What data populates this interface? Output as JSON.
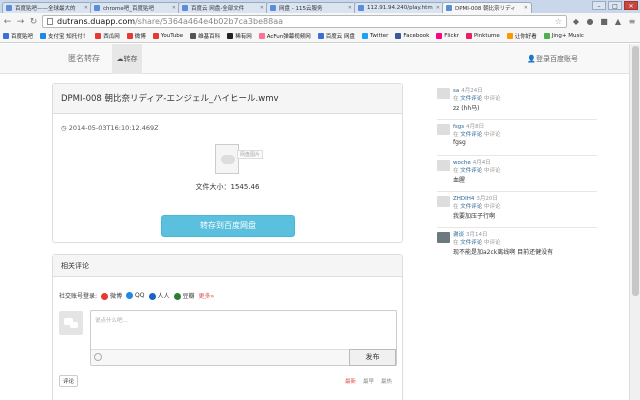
{
  "browser": {
    "tabs": [
      {
        "label": "百度贴吧——全球最大的"
      },
      {
        "label": "chrome吧_百度贴吧"
      },
      {
        "label": "百度云 网盘-全部文件"
      },
      {
        "label": "网盘 - 115云服务"
      },
      {
        "label": "112.91.94.240/play.htm"
      },
      {
        "label": "DPMI-008 朝比奈リディ",
        "active": true
      }
    ],
    "url_host": "dutrans.duapp.com",
    "url_path": "/share/5364a464e4b02b7ca3be88aa",
    "bookmarks": [
      {
        "label": "百度贴吧",
        "color": "#3a6fd8"
      },
      {
        "label": "支付宝 知托付！",
        "color": "#1e88e5"
      },
      {
        "label": "西瓜网",
        "color": "#e53935"
      },
      {
        "label": "微博",
        "color": "#e53935"
      },
      {
        "label": "YouTube",
        "color": "#e53935"
      },
      {
        "label": "维基百科",
        "color": "#555555"
      },
      {
        "label": "稀有网",
        "color": "#222222"
      },
      {
        "label": "AcFun弹幕视频网",
        "color": "#fb7299"
      },
      {
        "label": "百度云 网盘",
        "color": "#3a6fd8"
      },
      {
        "label": "Twitter",
        "color": "#1da1f2"
      },
      {
        "label": "Facebook",
        "color": "#3b5998"
      },
      {
        "label": "Flickr",
        "color": "#ff0084"
      },
      {
        "label": "Pinktume",
        "color": "#e91e63"
      },
      {
        "label": "让你好看",
        "color": "#ff9800"
      },
      {
        "label": "Jing+ Music",
        "color": "#4caf50"
      }
    ]
  },
  "site": {
    "brand": "匿名转存",
    "nav_save": "转存",
    "login": "登录百度账号"
  },
  "file": {
    "title": "DPMI-008 朝比奈リディア-エンジェル_ハイヒール.wmv",
    "timestamp": "2014-05-03T16:10:12.469Z",
    "icon_label": "网盘图片",
    "size_text": "文件大小：1545.46",
    "save_button": "转存到百度网盘"
  },
  "comments": {
    "header": "相关评论",
    "social_label": "社交账号登录:",
    "providers": [
      {
        "label": "微博",
        "color": "#e53935"
      },
      {
        "label": "QQ",
        "color": "#1e88e5"
      },
      {
        "label": "人人",
        "color": "#1565c0"
      },
      {
        "label": "豆瓣",
        "color": "#2e7d32"
      }
    ],
    "more": "更多»",
    "placeholder": "说点什么吧...",
    "post_button": "发布",
    "tab": "评论",
    "sorts": [
      "最新",
      "最早",
      "最热"
    ]
  },
  "sidebar": [
    {
      "user": "sa",
      "date": "4月24日",
      "prefix": "在",
      "link": "文件评论",
      "suffix": "中评论",
      "text": "zz (hh马)"
    },
    {
      "user": "fsgs",
      "date": "4月8日",
      "prefix": "在",
      "link": "文件评论",
      "suffix": "中评论",
      "text": "fgsg"
    },
    {
      "user": "woche",
      "date": "4月4日",
      "prefix": "在",
      "link": "文件评论",
      "suffix": "中评论",
      "text": "血腥"
    },
    {
      "user": "ZHDIH4",
      "date": "3月20日",
      "prefix": "在",
      "link": "文件评论",
      "suffix": "中评论",
      "text": "我要加压子行啊"
    },
    {
      "user": "谢谈",
      "date": "3月14日",
      "prefix": "在",
      "link": "文件评论",
      "suffix": "中评论",
      "text": "现不能是加a2ck离线啊 目前还健没有"
    }
  ]
}
